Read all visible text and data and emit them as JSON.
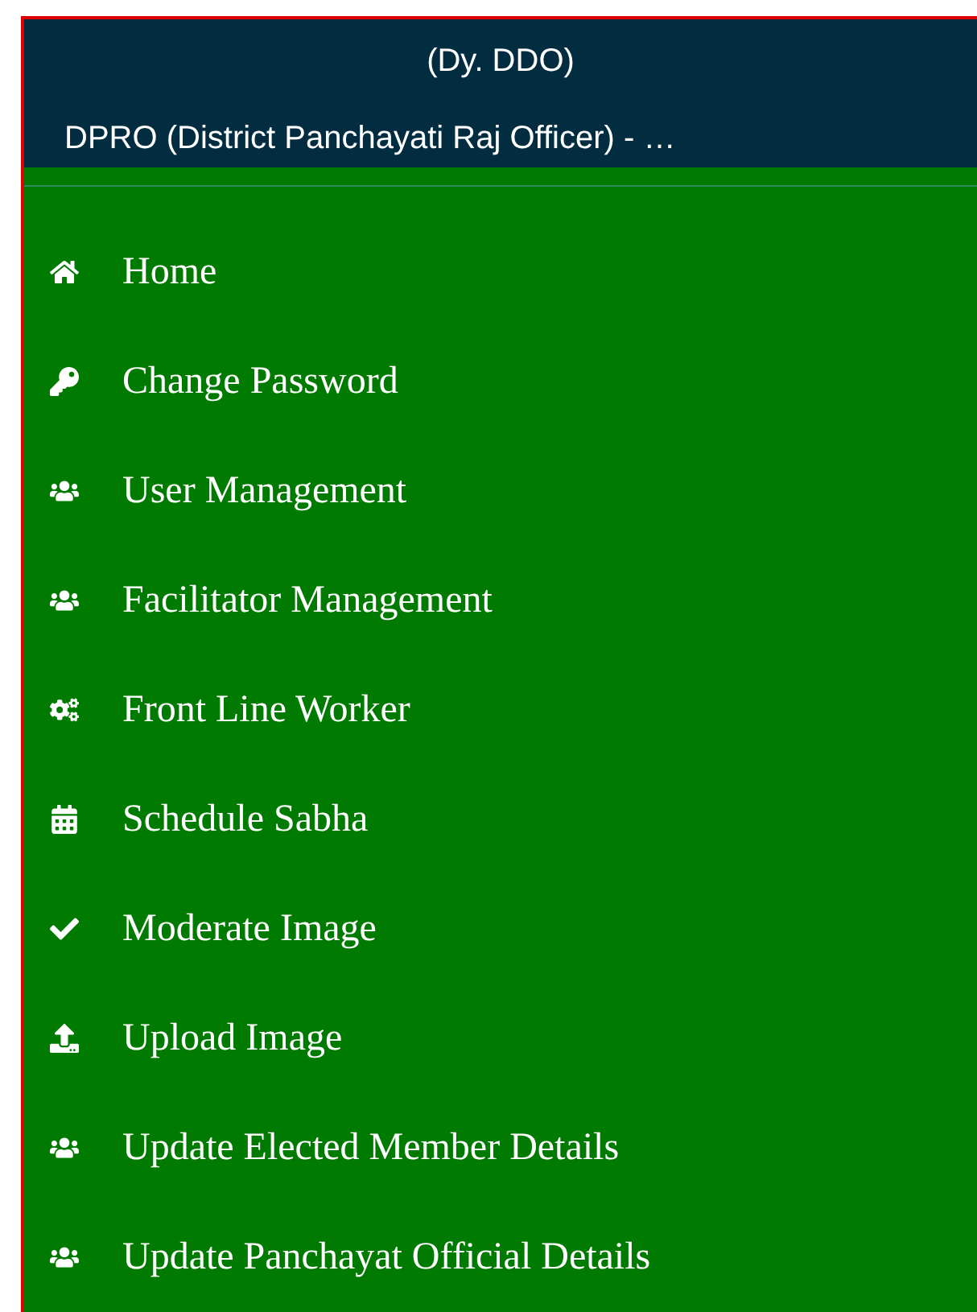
{
  "header": {
    "role": "(Dy. DDO)",
    "office": "DPRO (District Panchayati Raj Officer) - …"
  },
  "menu": [
    {
      "label": "Home",
      "kind": "home"
    },
    {
      "label": "Change Password",
      "kind": "key"
    },
    {
      "label": "User Management",
      "kind": "users"
    },
    {
      "label": "Facilitator Management",
      "kind": "users"
    },
    {
      "label": "Front Line Worker",
      "kind": "cogs"
    },
    {
      "label": "Schedule Sabha",
      "kind": "calendar"
    },
    {
      "label": "Moderate Image",
      "kind": "check"
    },
    {
      "label": "Upload Image",
      "kind": "upload"
    },
    {
      "label": "Update Elected Member Details",
      "kind": "users"
    },
    {
      "label": "Update Panchayat Official Details",
      "kind": "users"
    }
  ]
}
